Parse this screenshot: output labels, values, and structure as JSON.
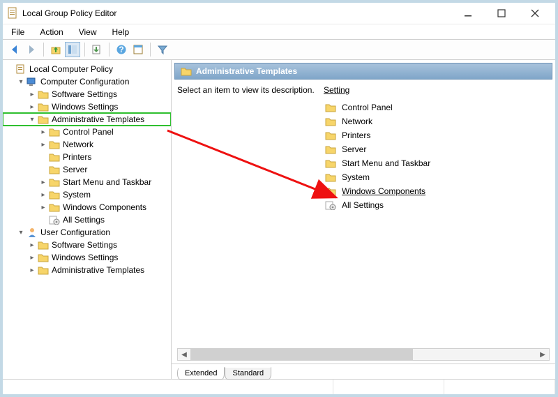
{
  "titlebar": {
    "title": "Local Group Policy Editor"
  },
  "menubar": [
    "File",
    "Action",
    "View",
    "Help"
  ],
  "toolbar_icons": [
    "back-icon",
    "forward-icon",
    "up-icon",
    "show-hide-tree-icon",
    "export-icon",
    "refresh-icon",
    "properties-icon",
    "filter-icon"
  ],
  "tree": {
    "root": "Local Computer Policy",
    "nodes": [
      {
        "label": "Computer Configuration",
        "iconType": "computer",
        "expanded": true,
        "children": [
          {
            "label": "Software Settings",
            "iconType": "folder",
            "expanded": false
          },
          {
            "label": "Windows Settings",
            "iconType": "folder",
            "expanded": false
          },
          {
            "label": "Administrative Templates",
            "iconType": "folder",
            "expanded": true,
            "highlighted": true,
            "children": [
              {
                "label": "Control Panel",
                "iconType": "folder",
                "expanded": false
              },
              {
                "label": "Network",
                "iconType": "folder",
                "expanded": false
              },
              {
                "label": "Printers",
                "iconType": "folder",
                "leaf": true
              },
              {
                "label": "Server",
                "iconType": "folder",
                "leaf": true
              },
              {
                "label": "Start Menu and Taskbar",
                "iconType": "folder",
                "expanded": false
              },
              {
                "label": "System",
                "iconType": "folder",
                "expanded": false
              },
              {
                "label": "Windows Components",
                "iconType": "folder",
                "expanded": false
              },
              {
                "label": "All Settings",
                "iconType": "settings",
                "leaf": true
              }
            ]
          }
        ]
      },
      {
        "label": "User Configuration",
        "iconType": "user",
        "expanded": true,
        "children": [
          {
            "label": "Software Settings",
            "iconType": "folder",
            "expanded": false
          },
          {
            "label": "Windows Settings",
            "iconType": "folder",
            "expanded": false
          },
          {
            "label": "Administrative Templates",
            "iconType": "folder",
            "expanded": false
          }
        ]
      }
    ]
  },
  "right_panel": {
    "header": "Administrative Templates",
    "description_prompt": "Select an item to view its description.",
    "setting_header": "Setting",
    "settings": [
      {
        "label": "Control Panel",
        "iconType": "folder"
      },
      {
        "label": "Network",
        "iconType": "folder"
      },
      {
        "label": "Printers",
        "iconType": "folder"
      },
      {
        "label": "Server",
        "iconType": "folder"
      },
      {
        "label": "Start Menu and Taskbar",
        "iconType": "folder"
      },
      {
        "label": "System",
        "iconType": "folder"
      },
      {
        "label": "Windows Components",
        "iconType": "folder",
        "highlighted": true
      },
      {
        "label": "All Settings",
        "iconType": "settings"
      }
    ],
    "tabs": [
      "Extended",
      "Standard"
    ],
    "active_tab": 0
  }
}
